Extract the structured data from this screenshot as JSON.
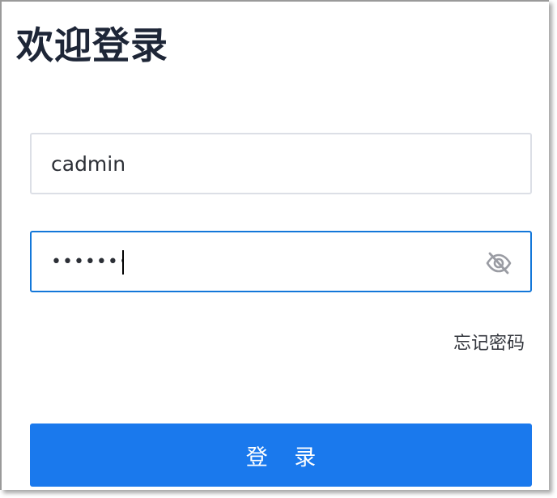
{
  "page": {
    "title": "欢迎登录"
  },
  "form": {
    "username": {
      "value": "cadmin"
    },
    "password": {
      "value": "•••••••••",
      "toggle_icon": "eye-off-icon"
    },
    "forgot_password_label": "忘记密码",
    "login_label": "登 录"
  },
  "colors": {
    "primary": "#1a79ed",
    "focus_border": "#1377d9",
    "default_border": "#dcdfe6",
    "title_text": "#1e2637",
    "icon": "#9a9ca3"
  }
}
